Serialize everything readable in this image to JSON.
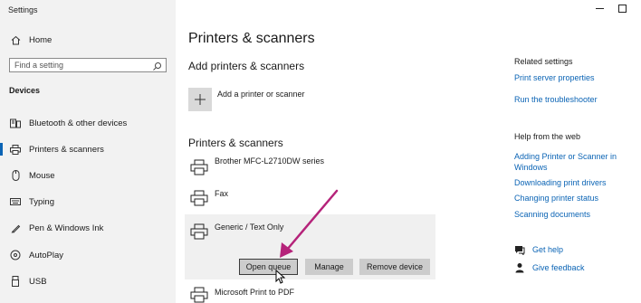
{
  "window": {
    "title": "Settings"
  },
  "sidebar": {
    "home_label": "Home",
    "search_placeholder": "Find a setting",
    "section_label": "Devices",
    "items": [
      {
        "label": "Bluetooth & other devices",
        "icon": "bluetooth-devices-icon"
      },
      {
        "label": "Printers & scanners",
        "icon": "printer-icon",
        "selected": true
      },
      {
        "label": "Mouse",
        "icon": "mouse-icon"
      },
      {
        "label": "Typing",
        "icon": "keyboard-icon"
      },
      {
        "label": "Pen & Windows Ink",
        "icon": "pen-icon"
      },
      {
        "label": "AutoPlay",
        "icon": "autoplay-icon"
      },
      {
        "label": "USB",
        "icon": "usb-icon"
      }
    ]
  },
  "main": {
    "title": "Printers & scanners",
    "add_section_title": "Add printers & scanners",
    "add_label": "Add a printer or scanner",
    "printers_section_title": "Printers & scanners",
    "printers": [
      {
        "name": "Brother MFC-L2710DW series"
      },
      {
        "name": "Fax"
      },
      {
        "name": "Generic / Text Only",
        "selected": true
      },
      {
        "name": "Microsoft Print to PDF"
      }
    ],
    "actions": {
      "open_queue": "Open queue",
      "manage": "Manage",
      "remove_device": "Remove device"
    }
  },
  "related": {
    "title": "Related settings",
    "links": [
      "Print server properties",
      "Run the troubleshooter"
    ]
  },
  "help": {
    "title": "Help from the web",
    "links": [
      "Adding Printer or Scanner in Windows",
      "Downloading print drivers",
      "Changing printer status",
      "Scanning documents"
    ]
  },
  "feedback": {
    "get_help": "Get help",
    "give_feedback": "Give feedback"
  },
  "colors": {
    "accent": "#0b64b5",
    "annotation_arrow": "#b5237a"
  }
}
